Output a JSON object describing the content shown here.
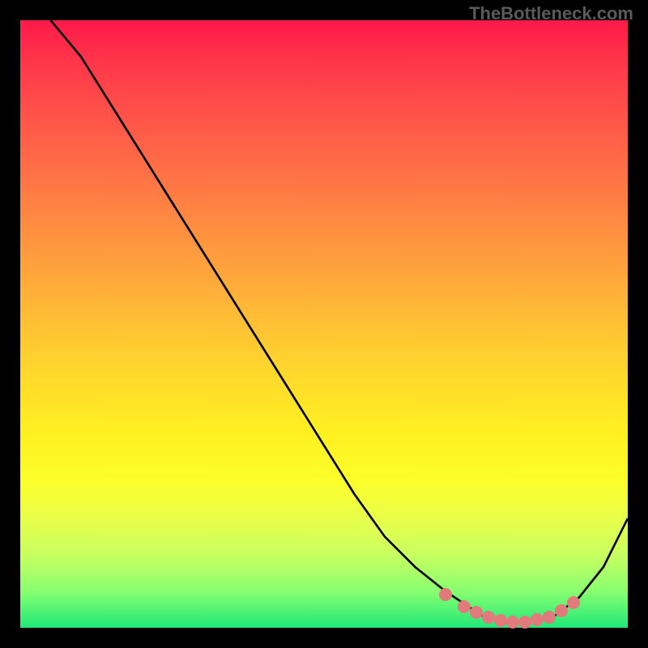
{
  "attribution": "TheBottleneck.com",
  "chart_data": {
    "type": "line",
    "title": "",
    "xlabel": "",
    "ylabel": "",
    "xlim": [
      0,
      100
    ],
    "ylim": [
      0,
      100
    ],
    "series": [
      {
        "name": "curve",
        "x": [
          5,
          10,
          15,
          20,
          25,
          30,
          35,
          40,
          45,
          50,
          55,
          60,
          65,
          70,
          73,
          76,
          80,
          84,
          88,
          92,
          96,
          100
        ],
        "y": [
          100,
          94,
          86,
          78,
          70,
          62,
          54,
          46,
          38,
          30,
          22,
          15,
          10,
          6,
          4,
          2,
          1,
          1,
          2,
          5,
          10,
          18
        ]
      }
    ],
    "markers": {
      "name": "highlight-points",
      "color": "#e2797c",
      "x": [
        70,
        73,
        75,
        77,
        79,
        81,
        83,
        85,
        87,
        89,
        91
      ],
      "y": [
        5.5,
        3.5,
        2.5,
        1.8,
        1.2,
        1.0,
        1.0,
        1.3,
        1.8,
        2.8,
        4.2
      ]
    }
  }
}
